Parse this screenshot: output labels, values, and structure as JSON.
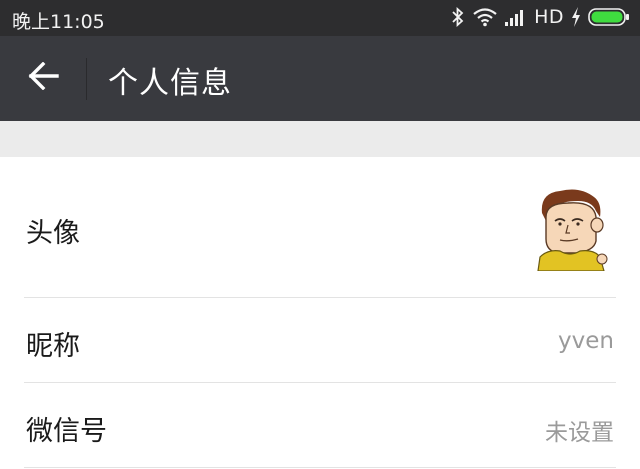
{
  "status_bar": {
    "time": "晚上11:05",
    "network": "HD",
    "icons": [
      "bluetooth-icon",
      "wifi-icon",
      "signal-icon",
      "charging-icon",
      "battery-icon"
    ],
    "battery_color": "#3fdc3f"
  },
  "nav": {
    "back_icon": "arrow-left-icon",
    "title": "个人信息"
  },
  "rows": [
    {
      "label": "头像",
      "value": ""
    },
    {
      "label": "昵称",
      "value": "yven"
    },
    {
      "label": "微信号",
      "value": "未设置"
    }
  ],
  "colors": {
    "status_bg": "#2d2d2f",
    "nav_bg": "#393a3f",
    "gap_bg": "#ebebeb",
    "value_text": "#9a9a9a"
  }
}
